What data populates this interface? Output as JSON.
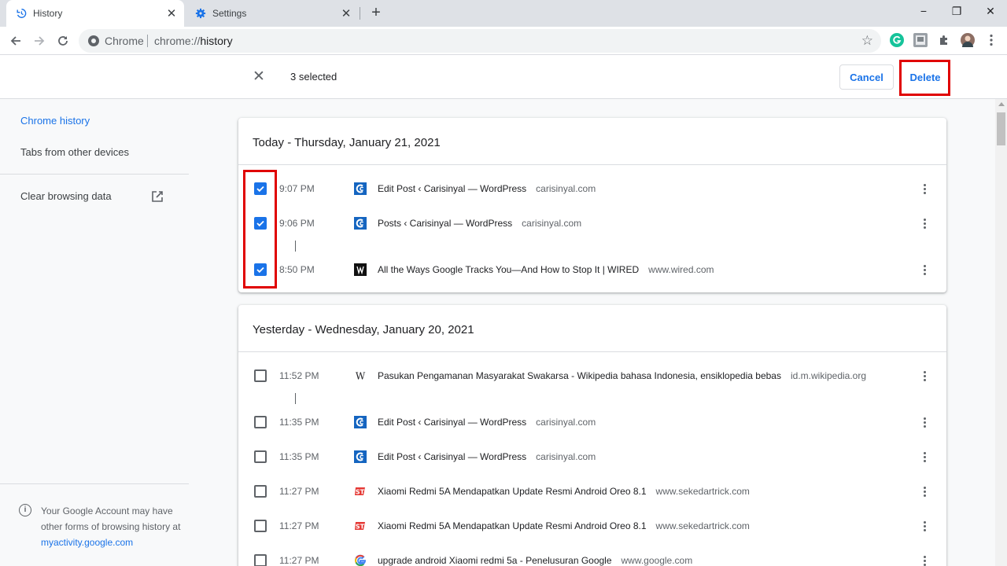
{
  "browser": {
    "tabs": [
      {
        "title": "History",
        "active": true,
        "icon": "history-icon"
      },
      {
        "title": "Settings",
        "active": false,
        "icon": "gear-icon"
      }
    ],
    "new_tab_symbol": "+",
    "window_controls": {
      "minimize": "−",
      "maximize": "❐",
      "close": "✕"
    },
    "omnibox": {
      "label": "Chrome",
      "url_prefix": "chrome://",
      "url_path": "history"
    }
  },
  "selection_bar": {
    "count_text": "3 selected",
    "cancel_label": "Cancel",
    "delete_label": "Delete"
  },
  "sidebar": {
    "items": [
      {
        "label": "Chrome history",
        "selected": true
      },
      {
        "label": "Tabs from other devices",
        "selected": false
      },
      {
        "label": "Clear browsing data",
        "selected": false
      }
    ],
    "info_text": "Your Google Account may have other forms of browsing history at",
    "info_link": "myactivity.google.com"
  },
  "history": [
    {
      "title": "Today - Thursday, January 21, 2021",
      "entries": [
        {
          "time": "9:07 PM",
          "title": "Edit Post ‹ Carisinyal — WordPress",
          "domain": "carisinyal.com",
          "checked": true,
          "favicon": "carisinyal-icon"
        },
        {
          "time": "9:06 PM",
          "title": "Posts ‹ Carisinyal — WordPress",
          "domain": "carisinyal.com",
          "checked": true,
          "favicon": "carisinyal-icon"
        },
        {
          "time": "8:50 PM",
          "title": "All the Ways Google Tracks You—And How to Stop It | WIRED",
          "domain": "www.wired.com",
          "checked": true,
          "favicon": "wired-icon"
        }
      ]
    },
    {
      "title": "Yesterday - Wednesday, January 20, 2021",
      "entries": [
        {
          "time": "11:52 PM",
          "title": "Pasukan Pengamanan Masyarakat Swakarsa - Wikipedia bahasa Indonesia, ensiklopedia bebas",
          "domain": "id.m.wikipedia.org",
          "checked": false,
          "favicon": "wikipedia-icon"
        },
        {
          "time": "11:35 PM",
          "title": "Edit Post ‹ Carisinyal — WordPress",
          "domain": "carisinyal.com",
          "checked": false,
          "favicon": "carisinyal-icon"
        },
        {
          "time": "11:35 PM",
          "title": "Edit Post ‹ Carisinyal — WordPress",
          "domain": "carisinyal.com",
          "checked": false,
          "favicon": "carisinyal-icon"
        },
        {
          "time": "11:27 PM",
          "title": "Xiaomi Redmi 5A Mendapatkan Update Resmi Android Oreo 8.1",
          "domain": "www.sekedartrick.com",
          "checked": false,
          "favicon": "sekedartrick-icon"
        },
        {
          "time": "11:27 PM",
          "title": "Xiaomi Redmi 5A Mendapatkan Update Resmi Android Oreo 8.1",
          "domain": "www.sekedartrick.com",
          "checked": false,
          "favicon": "sekedartrick-icon"
        },
        {
          "time": "11:27 PM",
          "title": "upgrade android Xiaomi redmi 5a - Penelusuran Google",
          "domain": "www.google.com",
          "checked": false,
          "favicon": "google-icon"
        }
      ]
    }
  ],
  "colors": {
    "accent": "#1a73e8",
    "highlight_box": "#e00000",
    "text": "#202124",
    "muted": "#5f6368"
  }
}
